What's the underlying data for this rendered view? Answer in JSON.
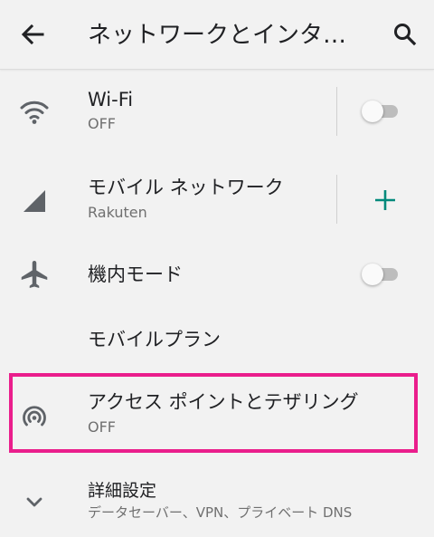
{
  "appbar": {
    "title": "ネットワークとインタ…",
    "back_icon": "arrow-back-icon",
    "search_icon": "search-icon"
  },
  "rows": {
    "wifi": {
      "title": "Wi-Fi",
      "subtitle": "OFF",
      "icon": "wifi-icon",
      "toggle_on": false
    },
    "mobile": {
      "title": "モバイル ネットワーク",
      "subtitle": "Rakuten",
      "icon": "cell-signal-icon",
      "action_icon": "plus-icon"
    },
    "airplane": {
      "title": "機内モード",
      "icon": "airplane-icon",
      "toggle_on": false
    },
    "plan": {
      "title": "モバイルプラン"
    },
    "hotspot": {
      "title": "アクセス ポイントとテザリング",
      "subtitle": "OFF",
      "icon": "hotspot-icon"
    },
    "advanced": {
      "title": "詳細設定",
      "subtitle": "データセーバー、VPN、プライベート DNS",
      "icon": "chevron-down-icon"
    }
  },
  "colors": {
    "accent": "#00897b",
    "highlight": "#ea1e8c",
    "icon_gray": "#5f6368",
    "background": "#f2f2f2"
  }
}
